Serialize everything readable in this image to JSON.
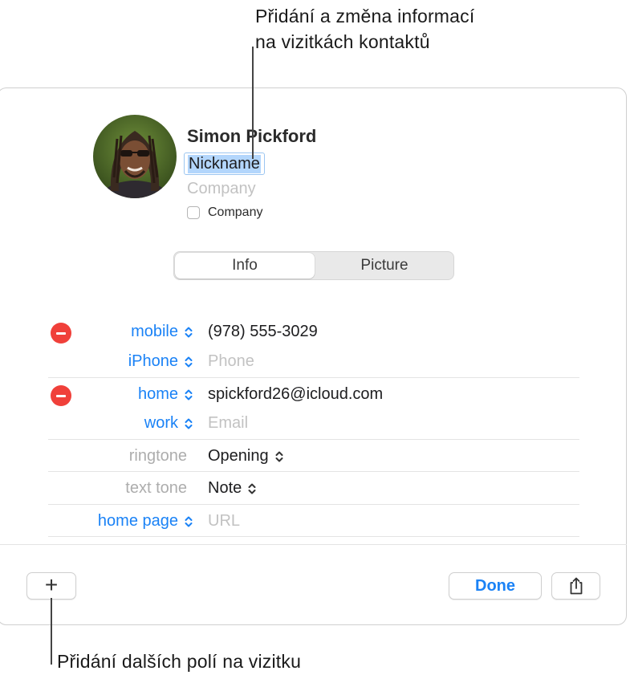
{
  "callouts": {
    "top_line1": "Přidání a změna informací",
    "top_line2": "na vizitkách kontaktů",
    "bottom": "Přidání dalších polí na vizitku"
  },
  "contact": {
    "name": "Simon Pickford",
    "nickname": "Nickname",
    "company_placeholder": "Company",
    "company_checkbox_label": "Company",
    "company_checked": false
  },
  "tabs": [
    {
      "label": "Info",
      "selected": true
    },
    {
      "label": "Picture",
      "selected": false
    }
  ],
  "fields": {
    "phone": [
      {
        "label": "mobile",
        "value": "(978) 555-3029",
        "placeholder": false
      },
      {
        "label": "iPhone",
        "value": "Phone",
        "placeholder": true
      }
    ],
    "email": [
      {
        "label": "home",
        "value": "spickford26@icloud.com",
        "placeholder": false
      },
      {
        "label": "work",
        "value": "Email",
        "placeholder": true
      }
    ],
    "ringtone": {
      "label": "ringtone",
      "value": "Opening"
    },
    "texttone": {
      "label": "text tone",
      "value": "Note"
    },
    "homepage": {
      "label": "home page",
      "value": "URL",
      "placeholder": true
    }
  },
  "buttons": {
    "add": "+",
    "done": "Done"
  },
  "icons": {
    "remove": "minus-circle-icon",
    "stepper": "chevron-up-down-icon",
    "share": "share-icon"
  },
  "colors": {
    "accent": "#1a82f6",
    "remove": "#f0403a",
    "selection": "#b3d6fc"
  }
}
